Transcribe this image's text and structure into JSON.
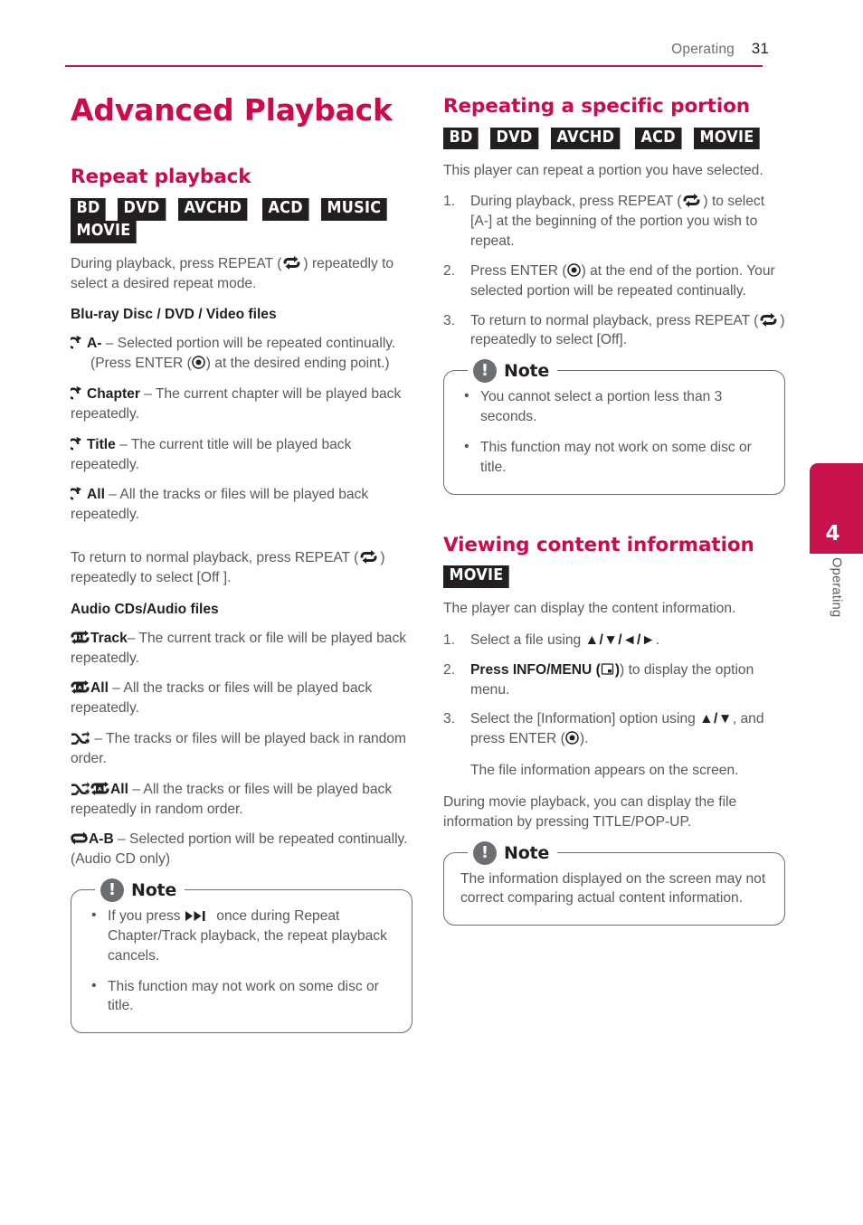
{
  "header": {
    "section": "Operating",
    "page_number": "31",
    "rule_color": "#c8134f"
  },
  "side_tab": {
    "number": "4",
    "label": "Operating",
    "color": "#c8134f"
  },
  "left_column": {
    "page_title": "Advanced Playback",
    "section": {
      "title": "Repeat playback",
      "badges": [
        "BD",
        "DVD",
        "AVCHD",
        "ACD",
        "MUSIC",
        "MOVIE"
      ],
      "intro_pre": "During playback, press REPEAT (",
      "intro_post": ") repeatedly to select a desired repeat mode.",
      "sub_video": "Blu-ray Disc / DVD / Video files",
      "video_modes": [
        {
          "icon": "repeat-arrow-icon",
          "term": "A-",
          "desc": " – Selected portion will be repeated continually.",
          "line2_pre": "(Press ENTER (",
          "line2_post": ") at the desired ending point.)"
        },
        {
          "icon": "repeat-arrow-icon",
          "term": "Chapter",
          "desc": " – The current chapter will be played back repeatedly."
        },
        {
          "icon": "repeat-arrow-icon",
          "term": "Title",
          "desc": " – The current title will be played back repeatedly."
        },
        {
          "icon": "repeat-arrow-icon",
          "term": "All",
          "desc": " – All the tracks or files will be played back repeatedly."
        }
      ],
      "return_pre": "To return to normal playback, press REPEAT (",
      "return_post": ") repeatedly to select [Off ].",
      "sub_audio": "Audio CDs/Audio files",
      "audio_modes": [
        {
          "icon": "repeat-one-icon",
          "term": "Track",
          "desc": "– The current track or file will be played back repeatedly."
        },
        {
          "icon": "repeat-all-icon",
          "term": "All",
          "desc": " – All the tracks or files will be played back repeatedly."
        },
        {
          "icon": "shuffle-icon",
          "term": "",
          "desc": " – The tracks or files will be played back in random order."
        },
        {
          "icon": "shuffle-repeat-all-icon",
          "term": "All",
          "desc": " – All the tracks or files will be played back repeatedly in random order."
        },
        {
          "icon": "repeat-ab-icon",
          "term": "A-B",
          "desc": " – Selected portion will be repeated continually. (Audio CD only)"
        }
      ],
      "note": {
        "title": "Note",
        "badge": "!",
        "items_pre": [
          "If you press ",
          "This function may not work on some disc or title."
        ],
        "item1_post": " once during Repeat Chapter/Track playback, the repeat playback cancels.",
        "item1_icon": "fast-forward-icon"
      }
    }
  },
  "right_column": {
    "section_repeat": {
      "title": "Repeating a specific portion",
      "badges": [
        "BD",
        "DVD",
        "AVCHD",
        "ACD",
        "MOVIE"
      ],
      "intro": "This player can repeat a portion you have selected.",
      "steps": [
        {
          "pre": "During playback, press REPEAT (",
          "icon": "repeat-icon",
          "post": ") to select [A-] at the beginning of the portion you wish to repeat."
        },
        {
          "pre": "Press ENTER (",
          "icon": "enter-icon",
          "post": ") at the end of the portion. Your selected portion will be repeated continually."
        },
        {
          "pre": "To return to normal playback, press REPEAT (",
          "icon": "repeat-icon",
          "post": ") repeatedly to select [Off]."
        }
      ],
      "note": {
        "title": "Note",
        "badge": "!",
        "items": [
          "You cannot select a portion less than 3 seconds.",
          "This function may not work on some disc or title."
        ]
      }
    },
    "section_info": {
      "title": "Viewing content information",
      "badges": [
        "MOVIE"
      ],
      "intro": "The player can display the content information.",
      "steps": [
        {
          "pre": "Select a file using ",
          "icon": "dpad-arrows-icon",
          "arrows": "▲/▼/◄/►",
          "post": "."
        },
        {
          "pre": "Press INFO/MENU (",
          "icon": "info-menu-icon",
          "post": ") to display the option menu."
        },
        {
          "pre": "Select the [Information] option using ",
          "arrows": "▲/▼",
          "mid": ", and press ENTER (",
          "icon": "enter-icon",
          "post": ")."
        }
      ],
      "substep": "The file information appears on the screen.",
      "trailing": "During movie playback, you can display the file information by pressing TITLE/POP-UP.",
      "note": {
        "title": "Note",
        "badge": "!",
        "text": "The information displayed on the screen may not correct comparing actual content information."
      }
    }
  }
}
